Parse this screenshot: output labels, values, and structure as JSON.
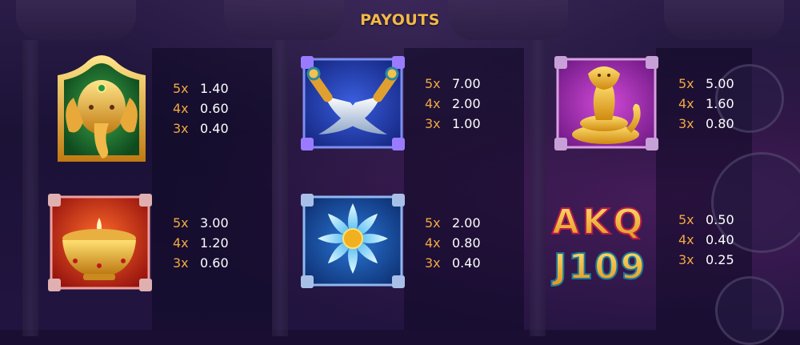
{
  "header": {
    "title": "PAYOUTS"
  },
  "symbols": [
    {
      "name": "ganesha",
      "payouts": [
        {
          "mult": "5x",
          "value": "1.40"
        },
        {
          "mult": "4x",
          "value": "0.60"
        },
        {
          "mult": "3x",
          "value": "0.40"
        }
      ]
    },
    {
      "name": "crossed-swords",
      "payouts": [
        {
          "mult": "5x",
          "value": "7.00"
        },
        {
          "mult": "4x",
          "value": "2.00"
        },
        {
          "mult": "3x",
          "value": "1.00"
        }
      ]
    },
    {
      "name": "cobra",
      "payouts": [
        {
          "mult": "5x",
          "value": "5.00"
        },
        {
          "mult": "4x",
          "value": "1.60"
        },
        {
          "mult": "3x",
          "value": "0.80"
        }
      ]
    },
    {
      "name": "diya-lamp",
      "payouts": [
        {
          "mult": "5x",
          "value": "3.00"
        },
        {
          "mult": "4x",
          "value": "1.20"
        },
        {
          "mult": "3x",
          "value": "0.60"
        }
      ]
    },
    {
      "name": "lotus",
      "payouts": [
        {
          "mult": "5x",
          "value": "2.00"
        },
        {
          "mult": "4x",
          "value": "0.80"
        },
        {
          "mult": "3x",
          "value": "0.40"
        }
      ]
    },
    {
      "name": "card-royals",
      "letters_top": "AKQ",
      "letters_bottom": "J109",
      "payouts": [
        {
          "mult": "5x",
          "value": "0.50"
        },
        {
          "mult": "4x",
          "value": "0.40"
        },
        {
          "mult": "3x",
          "value": "0.25"
        }
      ]
    }
  ],
  "colors": {
    "accent": "#f3b948",
    "multiplier": "#f0a843",
    "value": "#ffffff",
    "background": "#1a0f33"
  }
}
